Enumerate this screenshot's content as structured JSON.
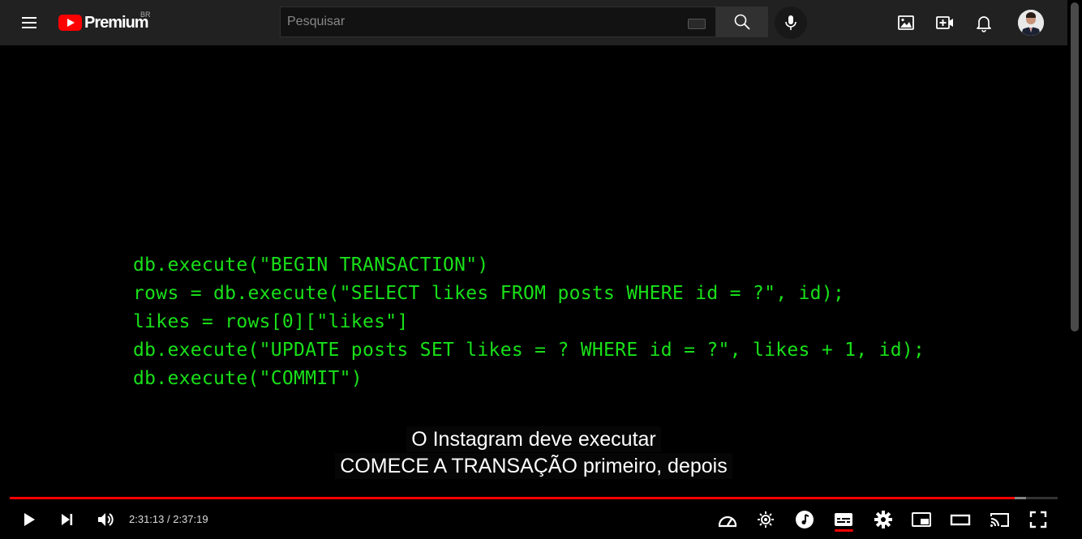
{
  "header": {
    "logo_text": "Premium",
    "country_code": "BR",
    "search_placeholder": "Pesquisar",
    "brand_color": "#ff0000"
  },
  "icons": {
    "menu": "hamburger-icon",
    "search": "search-icon",
    "mic": "microphone-icon",
    "image": "image-icon",
    "create": "create-video-icon",
    "notifications": "bell-icon",
    "avatar": "user-avatar"
  },
  "video": {
    "code_lines": [
      "db.execute(\"BEGIN TRANSACTION\")",
      "rows = db.execute(\"SELECT likes FROM posts WHERE id = ?\", id);",
      "likes = rows[0][\"likes\"]",
      "db.execute(\"UPDATE posts SET likes = ? WHERE id = ?\", likes + 1, id);",
      "db.execute(\"COMMIT\")"
    ],
    "code_color": "#19e019",
    "captions": [
      "O Instagram deve executar",
      "COMECE A TRANSAÇÃO primeiro, depois"
    ]
  },
  "player": {
    "time_display": "2:31:13 / 2:37:19",
    "progress_played": 0.959,
    "progress_loaded": 0.97,
    "progress_color": "#ff0000",
    "controls": [
      "play",
      "next",
      "volume",
      "autoplay",
      "settings-gear-brightness",
      "music",
      "subtitles",
      "settings",
      "miniplayer",
      "theater",
      "cast",
      "fullscreen"
    ]
  }
}
